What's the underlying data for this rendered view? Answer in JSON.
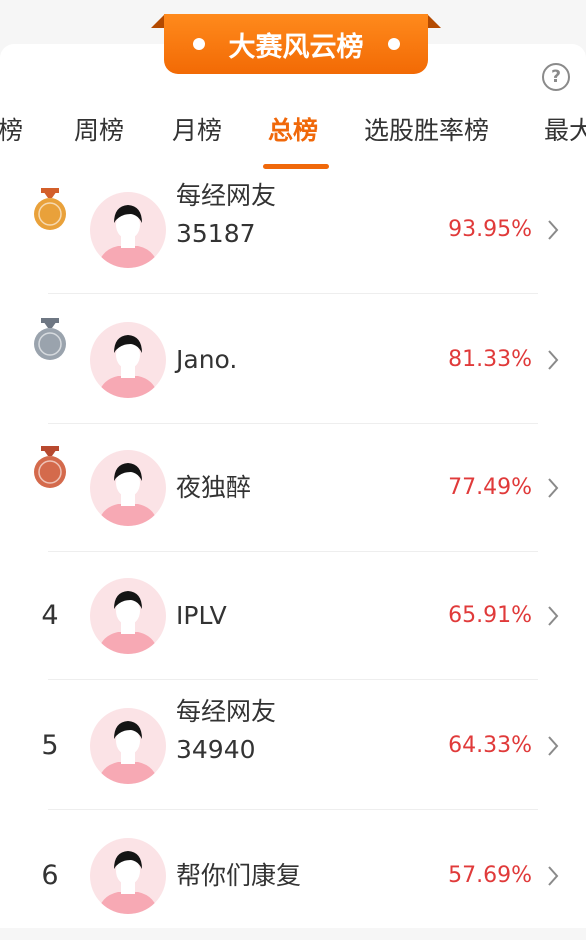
{
  "banner": {
    "title": "大赛风云榜"
  },
  "help_glyph": "?",
  "tabs": [
    {
      "label": "榜"
    },
    {
      "label": "周榜"
    },
    {
      "label": "月榜"
    },
    {
      "label": "总榜"
    },
    {
      "label": "选股胜率榜"
    },
    {
      "label": "最大"
    }
  ],
  "active_tab": "总榜",
  "colors": {
    "accent": "#f0680a",
    "rate": "#e03a3a",
    "gold": "#e9a13a",
    "silver": "#9aa3ad",
    "bronze": "#d46a4c"
  },
  "rows": [
    {
      "rank": "1",
      "medal": "gold-medal-icon",
      "name_line1": "每经网友",
      "name_line2": "35187",
      "rate": "93.95%"
    },
    {
      "rank": "2",
      "medal": "silver-medal-icon",
      "name_line1": "Jano.",
      "name_line2": "",
      "rate": "81.33%"
    },
    {
      "rank": "3",
      "medal": "bronze-medal-icon",
      "name_line1": "夜独醉",
      "name_line2": "",
      "rate": "77.49%"
    },
    {
      "rank": "4",
      "medal": "",
      "name_line1": "IPLV",
      "name_line2": "",
      "rate": "65.91%"
    },
    {
      "rank": "5",
      "medal": "",
      "name_line1": "每经网友",
      "name_line2": "34940",
      "rate": "64.33%"
    },
    {
      "rank": "6",
      "medal": "",
      "name_line1": "帮你们康复",
      "name_line2": "",
      "rate": "57.69%"
    }
  ]
}
